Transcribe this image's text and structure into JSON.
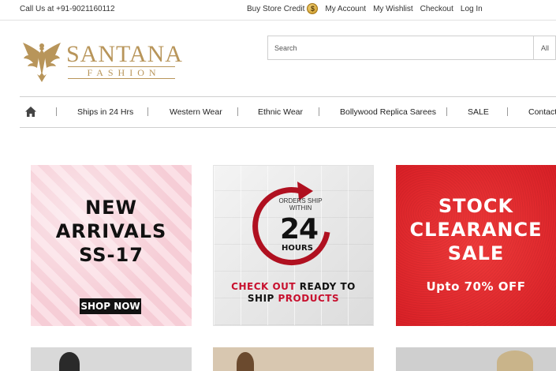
{
  "topbar": {
    "phone": "Call Us at +91-9021160112",
    "store_credit": "Buy Store Credit",
    "coin_symbol": "$",
    "my_account": "My Account",
    "my_wishlist": "My Wishlist",
    "checkout": "Checkout",
    "login": "Log In"
  },
  "logo": {
    "brand": "SANTANA",
    "sub": "FASHION",
    "color": "#b8955a"
  },
  "search": {
    "placeholder": "Search",
    "category": "All"
  },
  "nav": {
    "home_icon": "home-icon",
    "items": [
      "Ships in 24 Hrs",
      "Western Wear",
      "Ethnic Wear",
      "Bollywood Replica Sarees",
      "SALE",
      "Contact"
    ]
  },
  "banners": {
    "new_arrivals": {
      "line1": "NEW",
      "line2": "ARRIVALS",
      "line3": "SS-17",
      "button": "SHOP NOW"
    },
    "ships24": {
      "orders_text": "ORDERS SHIP WITHIN",
      "number": "24",
      "hours": "HOURS",
      "check_out_red": "CHECK OUT",
      "ready_to": " READY TO",
      "ship": "SHIP ",
      "products_red": "PRODUCTS",
      "accent": "#c8102e"
    },
    "clearance": {
      "line1": "STOCK",
      "line2": "CLEARANCE",
      "line3": "SALE",
      "offer": "Upto 70% OFF",
      "bg": "#e02a2f"
    }
  }
}
